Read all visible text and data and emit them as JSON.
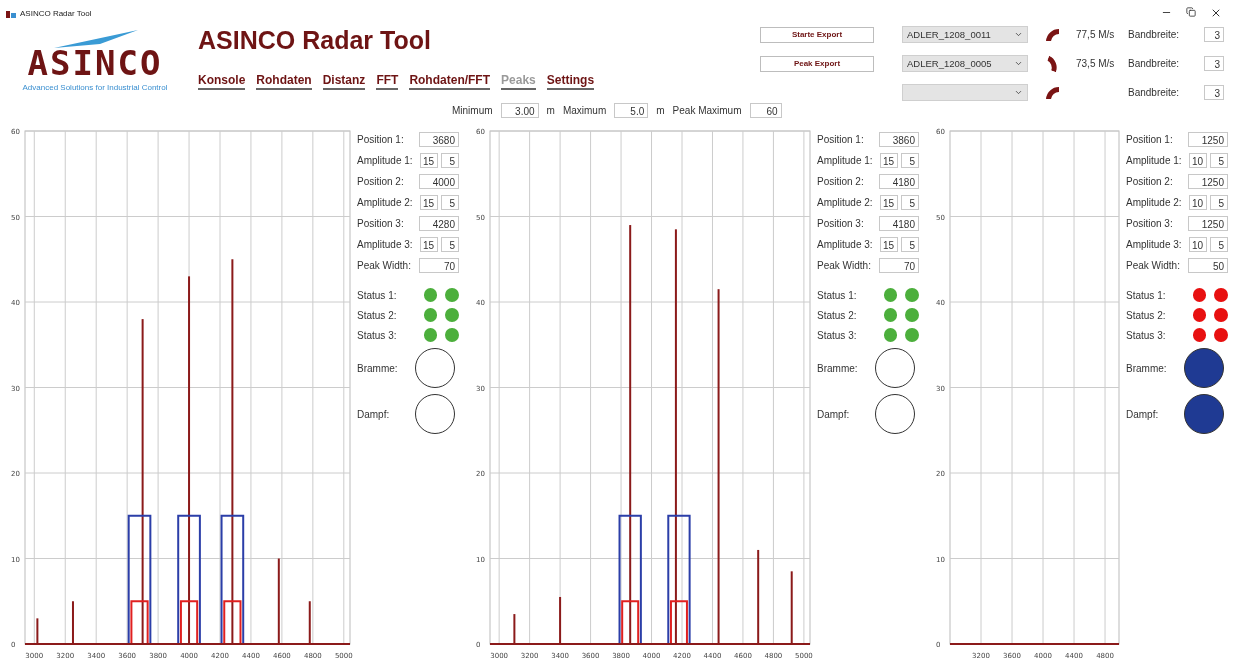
{
  "window": {
    "title": "ASINCO Radar Tool"
  },
  "logo": {
    "wordmark": "ASINCO",
    "tagline": "Advanced Solutions for Industrial Control"
  },
  "app_title": "ASINCO Radar Tool",
  "nav": [
    {
      "label": "Konsole",
      "selected": false
    },
    {
      "label": "Rohdaten",
      "selected": false
    },
    {
      "label": "Distanz",
      "selected": false
    },
    {
      "label": "FFT",
      "selected": false
    },
    {
      "label": "Rohdaten/FFT",
      "selected": false
    },
    {
      "label": "Peaks",
      "selected": true
    },
    {
      "label": "Settings",
      "selected": false
    }
  ],
  "range": {
    "min_label": "Minimum",
    "min": "3.00",
    "min_unit": "m",
    "max_label": "Maximum",
    "max": "5.0",
    "max_unit": "m",
    "peak_max_label": "Peak Maximum",
    "peak_max": "60"
  },
  "exports": [
    {
      "label": "Starte Export"
    },
    {
      "label": "Peak Export"
    }
  ],
  "channels": [
    {
      "file": "ADLER_1208_0011",
      "speed": "77,5 M/s",
      "band_label": "Bandbreite:",
      "band": "3"
    },
    {
      "file": "ADLER_1208_0005",
      "speed": "73,5 M/s",
      "band_label": "Bandbreite:",
      "band": "3"
    },
    {
      "band_label": "Bandbreite:",
      "band": "3"
    }
  ],
  "panels": [
    {
      "chart_data": {
        "type": "bar",
        "x": [
          3020,
          3250,
          3680,
          3700,
          4000,
          4280,
          4580,
          4780
        ],
        "series": [
          {
            "color": "#8b1a1a",
            "values": [
              3,
              5,
              null,
              38,
              43,
              45,
              10,
              5
            ]
          },
          {
            "color": "#2b3ea8",
            "values": [
              null,
              null,
              15,
              null,
              15,
              15,
              null,
              null
            ]
          },
          {
            "color": "#e02020",
            "values": [
              null,
              null,
              5,
              null,
              5,
              5,
              null,
              null
            ]
          }
        ],
        "xlim": [
          2940,
          5040
        ],
        "ylim": [
          0,
          60
        ],
        "xticks": [
          3000,
          3200,
          3400,
          3600,
          3800,
          4000,
          4200,
          4400,
          4600,
          4800,
          5000
        ],
        "yticks": [
          0,
          10,
          20,
          30,
          40,
          50,
          60
        ],
        "grid": true
      },
      "fields": [
        {
          "kind": "position",
          "label": "Position 1:",
          "values": [
            "3680"
          ]
        },
        {
          "kind": "amplitude",
          "label": "Amplitude 1:",
          "values": [
            "15",
            "5"
          ]
        },
        {
          "kind": "position",
          "label": "Position 2:",
          "values": [
            "4000"
          ]
        },
        {
          "kind": "amplitude",
          "label": "Amplitude 2:",
          "values": [
            "15",
            "5"
          ]
        },
        {
          "kind": "position",
          "label": "Position 3:",
          "values": [
            "4280"
          ]
        },
        {
          "kind": "amplitude",
          "label": "Amplitude 3:",
          "values": [
            "15",
            "5"
          ]
        },
        {
          "kind": "width",
          "label": "Peak Width:",
          "values": [
            "70"
          ]
        }
      ],
      "statuses": [
        {
          "label": "Status 1:",
          "dots": [
            {
              "color": "#4caf3c"
            },
            {
              "color": "#4caf3c"
            }
          ]
        },
        {
          "label": "Status 2:",
          "dots": [
            {
              "color": "#4caf3c"
            },
            {
              "color": "#4caf3c"
            }
          ]
        },
        {
          "label": "Status 3:",
          "dots": [
            {
              "color": "#4caf3c"
            },
            {
              "color": "#4caf3c"
            }
          ]
        }
      ],
      "indicators": [
        {
          "label": "Bramme:",
          "on": false
        },
        {
          "label": "Dampf:",
          "on": false
        }
      ]
    },
    {
      "chart_data": {
        "type": "bar",
        "x": [
          3100,
          3400,
          3860,
          4160,
          4180,
          4440,
          4700,
          4920
        ],
        "series": [
          {
            "color": "#8b1a1a",
            "values": [
              3.5,
              5.5,
              49,
              48.5,
              null,
              41.5,
              11,
              8.5
            ]
          },
          {
            "color": "#2b3ea8",
            "values": [
              null,
              null,
              15,
              null,
              15,
              null,
              null,
              null
            ]
          },
          {
            "color": "#e02020",
            "values": [
              null,
              null,
              5,
              null,
              5,
              null,
              null,
              null
            ]
          }
        ],
        "xlim": [
          2940,
          5040
        ],
        "ylim": [
          0,
          60
        ],
        "xticks": [
          3000,
          3200,
          3400,
          3600,
          3800,
          4000,
          4200,
          4400,
          4600,
          4800,
          5000
        ],
        "yticks": [
          0,
          10,
          20,
          30,
          40,
          50,
          60
        ],
        "grid": true
      },
      "fields": [
        {
          "kind": "position",
          "label": "Position 1:",
          "values": [
            "3860"
          ]
        },
        {
          "kind": "amplitude",
          "label": "Amplitude 1:",
          "values": [
            "15",
            "5"
          ]
        },
        {
          "kind": "position",
          "label": "Position 2:",
          "values": [
            "4180"
          ]
        },
        {
          "kind": "amplitude",
          "label": "Amplitude 2:",
          "values": [
            "15",
            "5"
          ]
        },
        {
          "kind": "position",
          "label": "Position 3:",
          "values": [
            "4180"
          ]
        },
        {
          "kind": "amplitude",
          "label": "Amplitude 3:",
          "values": [
            "15",
            "5"
          ]
        },
        {
          "kind": "width",
          "label": "Peak Width:",
          "values": [
            "70"
          ]
        }
      ],
      "statuses": [
        {
          "label": "Status 1:",
          "dots": [
            {
              "color": "#4caf3c"
            },
            {
              "color": "#4caf3c"
            }
          ]
        },
        {
          "label": "Status 2:",
          "dots": [
            {
              "color": "#4caf3c"
            },
            {
              "color": "#4caf3c"
            }
          ]
        },
        {
          "label": "Status 3:",
          "dots": [
            {
              "color": "#4caf3c"
            },
            {
              "color": "#4caf3c"
            }
          ]
        }
      ],
      "indicators": [
        {
          "label": "Bramme:",
          "on": false
        },
        {
          "label": "Dampf:",
          "on": false
        }
      ]
    },
    {
      "chart_data": {
        "type": "bar",
        "xlim": [
          2800,
          4980
        ],
        "ylim": [
          0,
          60
        ],
        "xticks": [
          3200,
          3600,
          4000,
          4400,
          4800
        ],
        "yticks": [
          0,
          10,
          20,
          30,
          40,
          50,
          60
        ],
        "grid": true
      },
      "fields": [
        {
          "kind": "position",
          "label": "Position 1:",
          "values": [
            "1250"
          ]
        },
        {
          "kind": "amplitude",
          "label": "Amplitude 1:",
          "values": [
            "10",
            "5"
          ]
        },
        {
          "kind": "position",
          "label": "Position 2:",
          "values": [
            "1250"
          ]
        },
        {
          "kind": "amplitude",
          "label": "Amplitude 2:",
          "values": [
            "10",
            "5"
          ]
        },
        {
          "kind": "position",
          "label": "Position 3:",
          "values": [
            "1250"
          ]
        },
        {
          "kind": "amplitude",
          "label": "Amplitude 3:",
          "values": [
            "10",
            "5"
          ]
        },
        {
          "kind": "width",
          "label": "Peak Width:",
          "values": [
            "50"
          ]
        }
      ],
      "statuses": [
        {
          "label": "Status 1:",
          "dots": [
            {
              "color": "#e81010"
            },
            {
              "color": "#e81010"
            }
          ]
        },
        {
          "label": "Status 2:",
          "dots": [
            {
              "color": "#e81010"
            },
            {
              "color": "#e81010"
            }
          ]
        },
        {
          "label": "Status 3:",
          "dots": [
            {
              "color": "#e81010"
            },
            {
              "color": "#e81010"
            }
          ]
        }
      ],
      "indicators": [
        {
          "label": "Bramme:",
          "on": true
        },
        {
          "label": "Dampf:",
          "on": true
        }
      ]
    }
  ]
}
